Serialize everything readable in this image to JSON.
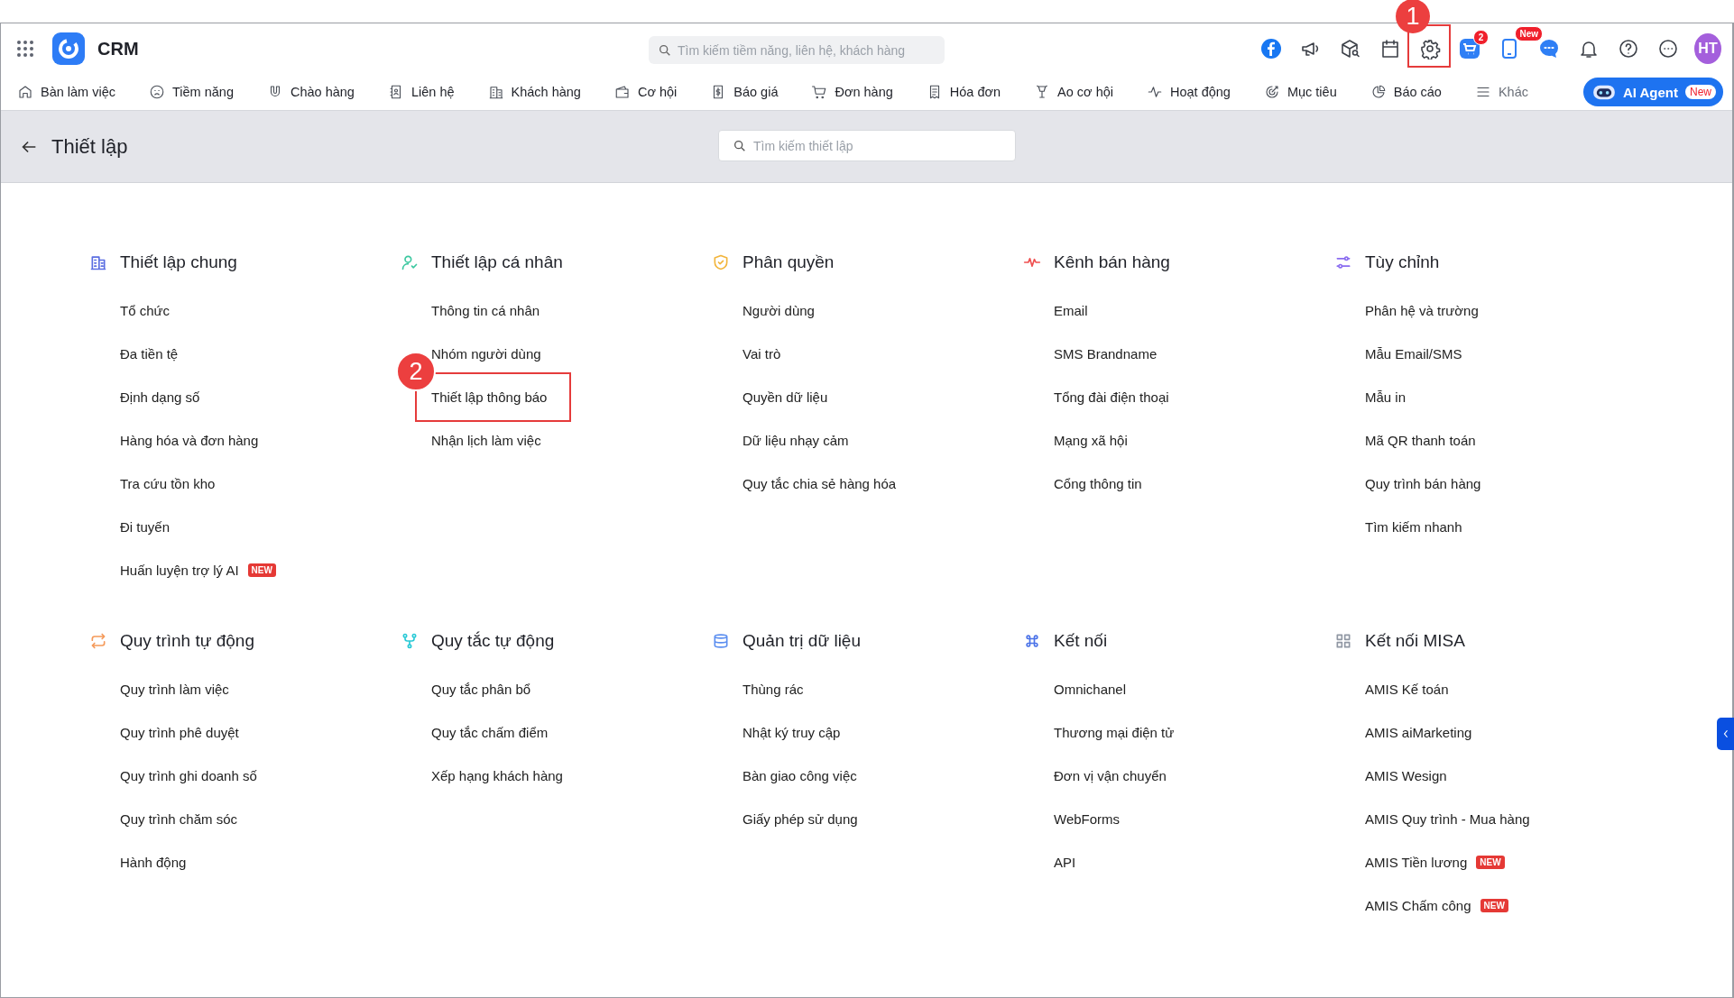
{
  "app": {
    "name": "CRM"
  },
  "search": {
    "placeholder": "Tìm kiếm tiềm năng, liên hệ, khách hàng"
  },
  "toolbar": [
    {
      "kind": "facebook"
    },
    {
      "kind": "megaphone"
    },
    {
      "kind": "box"
    },
    {
      "kind": "calendar"
    },
    {
      "kind": "settings",
      "callout": "1"
    },
    {
      "kind": "cart",
      "badge": "2"
    },
    {
      "kind": "phone",
      "badge": "New"
    },
    {
      "kind": "chat"
    },
    {
      "kind": "bell"
    },
    {
      "kind": "help"
    },
    {
      "kind": "more"
    },
    {
      "kind": "avatar",
      "label": "HT"
    }
  ],
  "nav": [
    {
      "label": "Bàn làm việc",
      "kind": "home"
    },
    {
      "label": "Tiềm năng",
      "kind": "face"
    },
    {
      "label": "Chào hàng",
      "kind": "magnet"
    },
    {
      "label": "Liên hệ",
      "kind": "contact"
    },
    {
      "label": "Khách hàng",
      "kind": "building"
    },
    {
      "label": "Cơ hội",
      "kind": "wallet"
    },
    {
      "label": "Báo giá",
      "kind": "quote"
    },
    {
      "label": "Đơn hàng",
      "kind": "cart"
    },
    {
      "label": "Hóa đơn",
      "kind": "receipt"
    },
    {
      "label": "Ao cơ hội",
      "kind": "funnel"
    },
    {
      "label": "Hoạt động",
      "kind": "activity"
    },
    {
      "label": "Mục tiêu",
      "kind": "target"
    },
    {
      "label": "Báo cáo",
      "kind": "pie"
    },
    {
      "label": "Khác",
      "kind": "menu"
    }
  ],
  "ai_agent": {
    "label": "AI Agent",
    "badge": "New"
  },
  "page": {
    "title": "Thiết lập",
    "search_placeholder": "Tìm kiếm thiết lập"
  },
  "sections": [
    {
      "title": "Thiết lập chung",
      "kind": "building",
      "items": [
        {
          "label": "Tổ chức"
        },
        {
          "label": "Đa tiền tệ"
        },
        {
          "label": "Định dạng số"
        },
        {
          "label": "Hàng hóa và đơn hàng"
        },
        {
          "label": "Tra cứu tồn kho"
        },
        {
          "label": "Đi tuyến"
        },
        {
          "label": "Huấn luyện trợ lý AI",
          "badge": "NEW"
        }
      ]
    },
    {
      "title": "Thiết lập cá nhân",
      "kind": "user-check",
      "items": [
        {
          "label": "Thông tin cá nhân"
        },
        {
          "label": "Nhóm người dùng"
        },
        {
          "label": "Thiết lập thông báo",
          "callout": "2"
        },
        {
          "label": "Nhận lịch làm việc"
        }
      ]
    },
    {
      "title": "Phân quyền",
      "kind": "shield",
      "items": [
        {
          "label": "Người dùng"
        },
        {
          "label": "Vai trò"
        },
        {
          "label": "Quyền dữ liệu"
        },
        {
          "label": "Dữ liệu nhạy cảm"
        },
        {
          "label": "Quy tắc chia sẻ hàng hóa"
        }
      ]
    },
    {
      "title": "Kênh bán hàng",
      "kind": "pulse",
      "items": [
        {
          "label": "Email"
        },
        {
          "label": "SMS Brandname"
        },
        {
          "label": "Tổng đài điện thoại"
        },
        {
          "label": "Mạng xã hội"
        },
        {
          "label": "Cổng thông tin"
        }
      ]
    },
    {
      "title": "Tùy chỉnh",
      "kind": "sliders",
      "items": [
        {
          "label": "Phân hệ và trường"
        },
        {
          "label": "Mẫu Email/SMS"
        },
        {
          "label": "Mẫu in"
        },
        {
          "label": "Mã QR thanh toán"
        },
        {
          "label": "Quy trình bán hàng"
        },
        {
          "label": "Tìm kiếm nhanh"
        }
      ]
    },
    {
      "title": "Quy trình tự động",
      "kind": "repeat",
      "items": [
        {
          "label": "Quy trình làm việc"
        },
        {
          "label": "Quy trình phê duyệt"
        },
        {
          "label": "Quy trình ghi doanh số"
        },
        {
          "label": "Quy trình chăm sóc"
        },
        {
          "label": "Hành động"
        }
      ]
    },
    {
      "title": "Quy tắc tự động",
      "kind": "fork",
      "items": [
        {
          "label": "Quy tắc phân bổ"
        },
        {
          "label": "Quy tắc chấm điểm"
        },
        {
          "label": "Xếp hạng khách hàng"
        }
      ]
    },
    {
      "title": "Quản trị dữ liệu",
      "kind": "database",
      "items": [
        {
          "label": "Thùng rác"
        },
        {
          "label": "Nhật ký truy cập"
        },
        {
          "label": "Bàn giao công việc"
        },
        {
          "label": "Giấy phép sử dụng"
        }
      ]
    },
    {
      "title": "Kết nối",
      "kind": "command",
      "items": [
        {
          "label": "Omnichanel"
        },
        {
          "label": "Thương mại điện tử"
        },
        {
          "label": "Đơn vị vận chuyển"
        },
        {
          "label": "WebForms"
        },
        {
          "label": "API"
        }
      ]
    },
    {
      "title": "Kết nối MISA",
      "kind": "apps",
      "items": [
        {
          "label": "AMIS Kế toán"
        },
        {
          "label": "AMIS aiMarketing"
        },
        {
          "label": "AMIS Wesign"
        },
        {
          "label": "AMIS Quy trình - Mua hàng"
        },
        {
          "label": "AMIS Tiền lương",
          "badge": "NEW"
        },
        {
          "label": "AMIS Chấm công",
          "badge": "NEW"
        }
      ]
    }
  ]
}
